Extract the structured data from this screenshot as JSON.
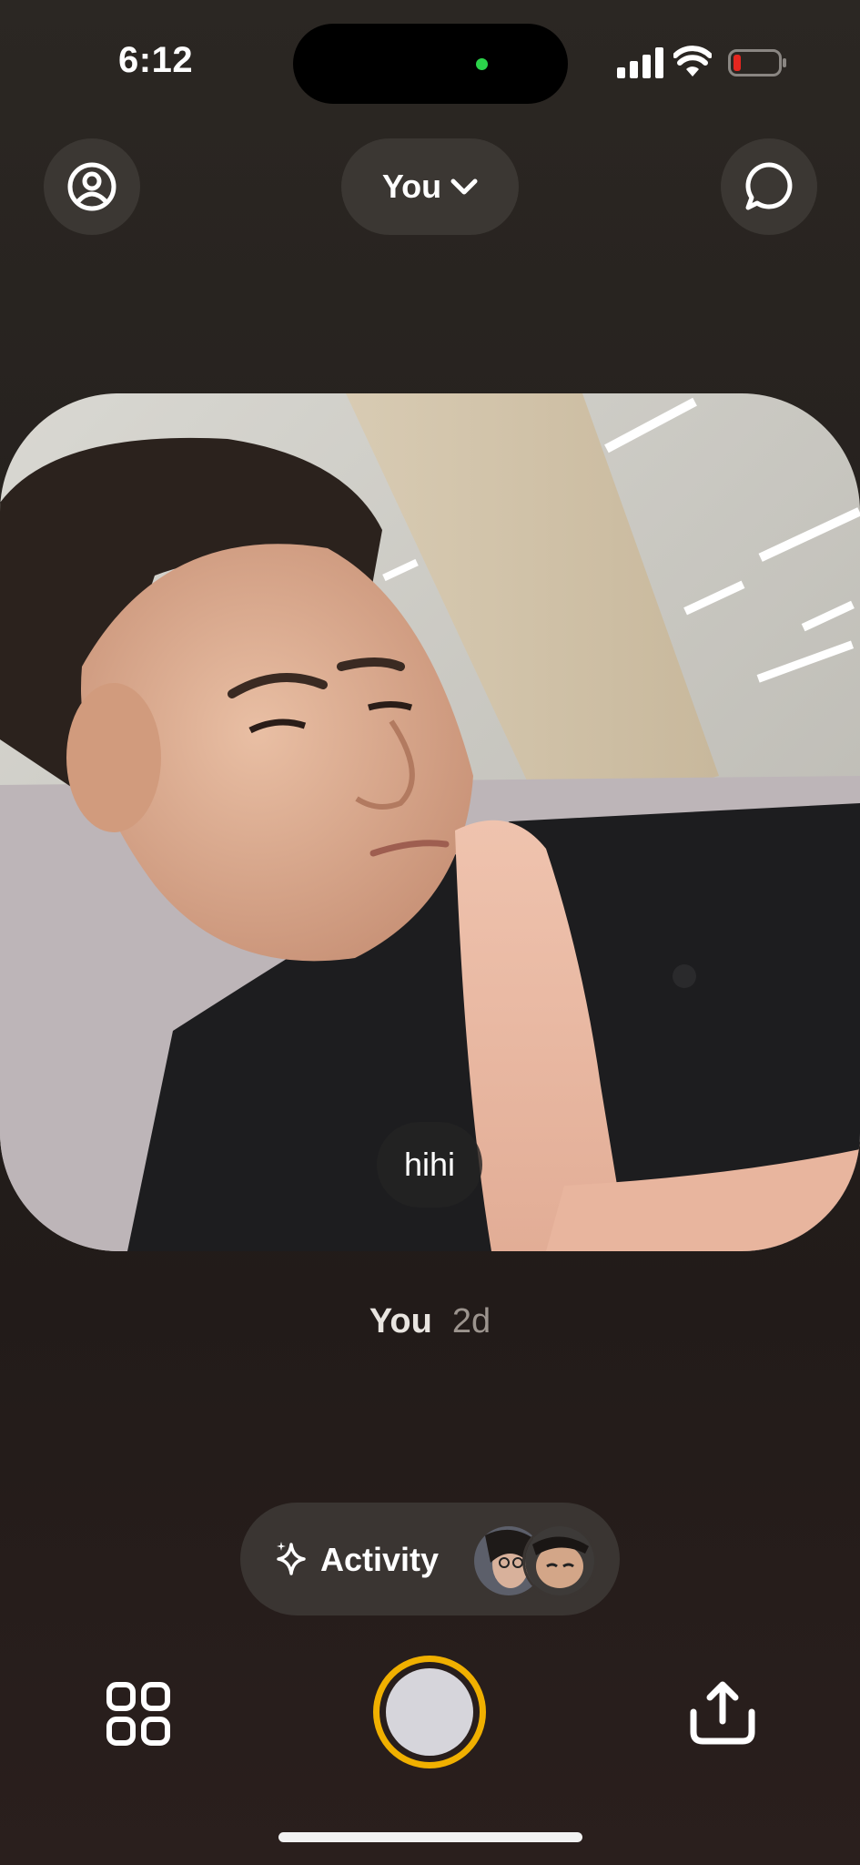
{
  "status_bar": {
    "time": "6:12"
  },
  "header": {
    "selector_label": "You"
  },
  "post": {
    "caption": "hihi",
    "author": "You",
    "age": "2d"
  },
  "activity": {
    "label": "Activity"
  },
  "colors": {
    "accent_ring": "#f0b000",
    "recording_dot": "#2bd34a",
    "battery_low": "#e5261f"
  },
  "icons": [
    "profile-icon",
    "chevron-down-icon",
    "chat-bubble-icon",
    "sparkle-icon",
    "grid-icon",
    "share-icon"
  ]
}
